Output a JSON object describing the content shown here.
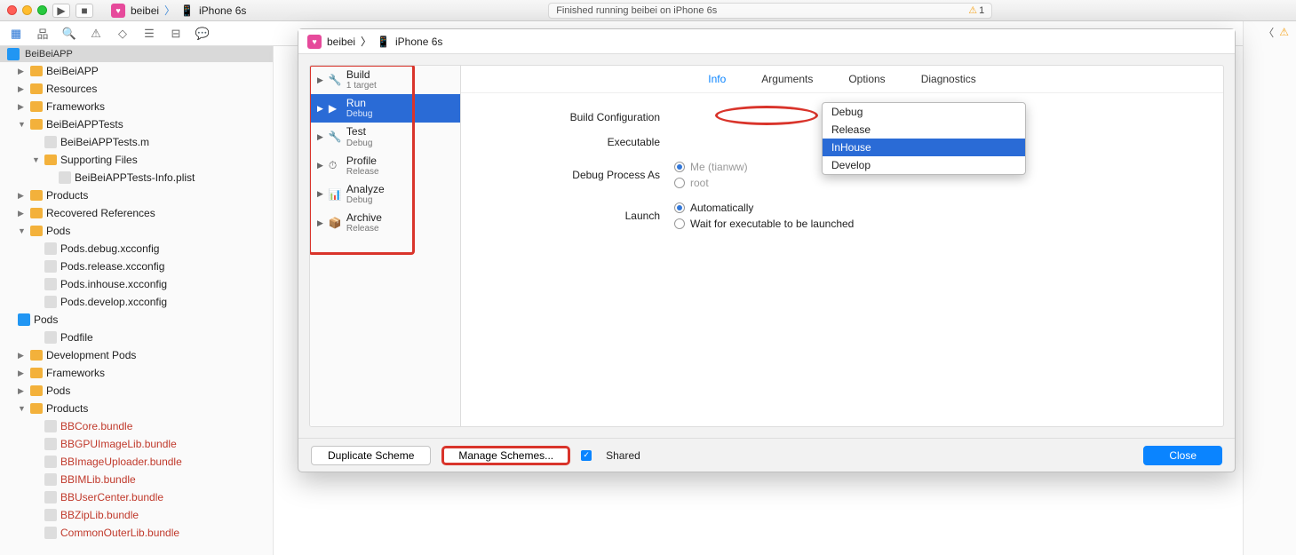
{
  "titlebar": {
    "project": "beibei",
    "device": "iPhone 6s",
    "status": "Finished running beibei on iPhone 6s",
    "warn_count": "1"
  },
  "nav": {
    "header": "BeiBeiAPP",
    "items": [
      {
        "d": 1,
        "disc": "▶",
        "type": "fld",
        "label": "BeiBeiAPP"
      },
      {
        "d": 1,
        "disc": "▶",
        "type": "fld",
        "label": "Resources"
      },
      {
        "d": 1,
        "disc": "▶",
        "type": "fld",
        "label": "Frameworks"
      },
      {
        "d": 1,
        "disc": "▼",
        "type": "fld",
        "label": "BeiBeiAPPTests"
      },
      {
        "d": 2,
        "disc": "",
        "type": "m",
        "label": "BeiBeiAPPTests.m"
      },
      {
        "d": 2,
        "disc": "▼",
        "type": "fld",
        "label": "Supporting Files"
      },
      {
        "d": 3,
        "disc": "",
        "type": "file",
        "label": "BeiBeiAPPTests-Info.plist"
      },
      {
        "d": 1,
        "disc": "▶",
        "type": "fld",
        "label": "Products"
      },
      {
        "d": 1,
        "disc": "▶",
        "type": "fld",
        "label": "Recovered References"
      },
      {
        "d": 1,
        "disc": "▼",
        "type": "fld",
        "label": "Pods"
      },
      {
        "d": 2,
        "disc": "",
        "type": "file",
        "label": "Pods.debug.xcconfig"
      },
      {
        "d": 2,
        "disc": "",
        "type": "file",
        "label": "Pods.release.xcconfig"
      },
      {
        "d": 2,
        "disc": "",
        "type": "file",
        "label": "Pods.inhouse.xcconfig"
      },
      {
        "d": 2,
        "disc": "",
        "type": "file",
        "label": "Pods.develop.xcconfig"
      },
      {
        "d": 0,
        "disc": "",
        "type": "proj",
        "label": "Pods"
      },
      {
        "d": 2,
        "disc": "",
        "type": "file",
        "label": "Podfile"
      },
      {
        "d": 1,
        "disc": "▶",
        "type": "fld",
        "label": "Development Pods"
      },
      {
        "d": 1,
        "disc": "▶",
        "type": "fld",
        "label": "Frameworks"
      },
      {
        "d": 1,
        "disc": "▶",
        "type": "fld",
        "label": "Pods"
      },
      {
        "d": 1,
        "disc": "▼",
        "type": "fld",
        "label": "Products"
      },
      {
        "d": 2,
        "disc": "",
        "type": "bundle",
        "label": "BBCore.bundle",
        "red": true
      },
      {
        "d": 2,
        "disc": "",
        "type": "bundle",
        "label": "BBGPUImageLib.bundle",
        "red": true
      },
      {
        "d": 2,
        "disc": "",
        "type": "bundle",
        "label": "BBImageUploader.bundle",
        "red": true
      },
      {
        "d": 2,
        "disc": "",
        "type": "bundle",
        "label": "BBIMLib.bundle",
        "red": true
      },
      {
        "d": 2,
        "disc": "",
        "type": "bundle",
        "label": "BBUserCenter.bundle",
        "red": true
      },
      {
        "d": 2,
        "disc": "",
        "type": "bundle",
        "label": "BBZipLib.bundle",
        "red": true
      },
      {
        "d": 2,
        "disc": "",
        "type": "bundle",
        "label": "CommonOuterLib.bundle",
        "red": true
      }
    ]
  },
  "modal": {
    "crumb_project": "beibei",
    "crumb_device": "iPhone 6s",
    "schemes": [
      {
        "title": "Build",
        "sub": "1 target",
        "icon": "🔧"
      },
      {
        "title": "Run",
        "sub": "Debug",
        "icon": "▶",
        "sel": true
      },
      {
        "title": "Test",
        "sub": "Debug",
        "icon": "🔧"
      },
      {
        "title": "Profile",
        "sub": "Release",
        "icon": "⏱"
      },
      {
        "title": "Analyze",
        "sub": "Debug",
        "icon": "📊"
      },
      {
        "title": "Archive",
        "sub": "Release",
        "icon": "📦"
      }
    ],
    "tabs": [
      "Info",
      "Arguments",
      "Options",
      "Diagnostics"
    ],
    "tab_selected": "Info",
    "build_config_label": "Build Configuration",
    "build_config_options": [
      "Debug",
      "Release",
      "InHouse",
      "Develop"
    ],
    "build_config_selected": "InHouse",
    "executable_label": "Executable",
    "debug_process_label": "Debug Process As",
    "debug_process_me": "Me (tianww)",
    "debug_process_root": "root",
    "launch_label": "Launch",
    "launch_auto": "Automatically",
    "launch_wait": "Wait for executable to be launched",
    "btn_duplicate": "Duplicate Scheme",
    "btn_manage": "Manage Schemes...",
    "shared_label": "Shared",
    "btn_close": "Close"
  }
}
